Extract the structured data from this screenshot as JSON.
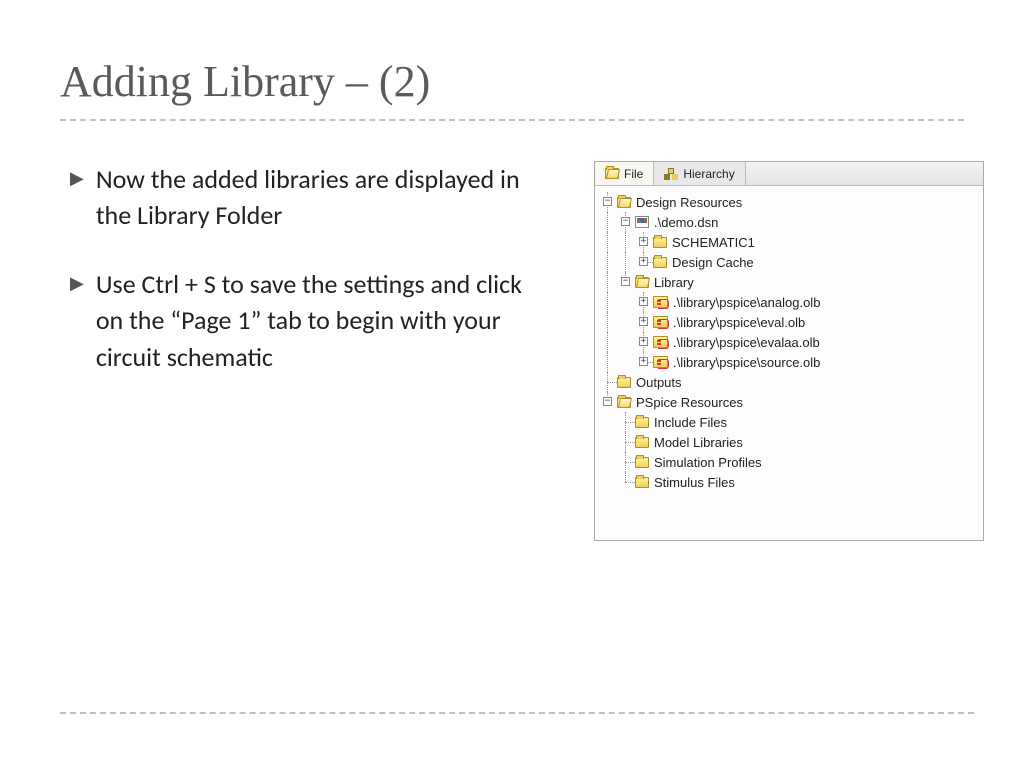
{
  "title": "Adding Library – (2)",
  "bullets": [
    "Now the added libraries are displayed in the Library Folder",
    "Use Ctrl + S to save the settings and click on the “Page 1” tab to begin with your circuit schematic"
  ],
  "panel": {
    "tabs": {
      "file": "File",
      "hierarchy": "Hierarchy"
    },
    "tree": {
      "design_resources": "Design Resources",
      "demo_dsn": ".\\demo.dsn",
      "schematic1": "SCHEMATIC1",
      "design_cache": "Design Cache",
      "library": "Library",
      "lib_analog": ".\\library\\pspice\\analog.olb",
      "lib_eval": ".\\library\\pspice\\eval.olb",
      "lib_evalaa": ".\\library\\pspice\\evalaa.olb",
      "lib_source": ".\\library\\pspice\\source.olb",
      "outputs": "Outputs",
      "pspice_resources": "PSpice Resources",
      "include_files": "Include Files",
      "model_libraries": "Model Libraries",
      "simulation_profiles": "Simulation Profiles",
      "stimulus_files": "Stimulus Files"
    }
  }
}
